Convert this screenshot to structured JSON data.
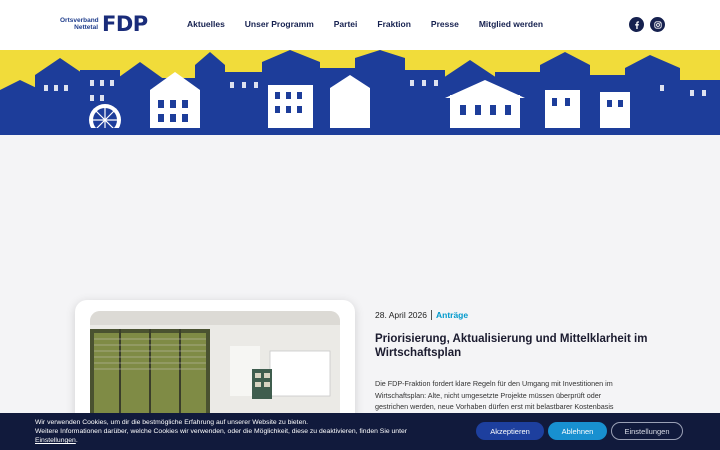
{
  "header": {
    "logo": {
      "line1": "Ortsverband",
      "line2": "Nettetal",
      "wordmark": "FDP"
    },
    "nav": [
      "Aktuelles",
      "Unser Programm",
      "Partei",
      "Fraktion",
      "Presse",
      "Mitglied werden"
    ],
    "social_icons": [
      "facebook-icon",
      "instagram-icon"
    ]
  },
  "colors": {
    "brand_blue": "#1a2c7a",
    "banner_yellow": "#f1dc3a",
    "banner_blue": "#1d3d9a",
    "accent_cyan": "#0099cc",
    "cookie_bg": "#111a3c"
  },
  "post": {
    "date": "28. April 2026",
    "category": "Anträge",
    "title": "Priorisierung, Aktualisierung und Mittelklarheit im Wirtschaftsplan",
    "excerpt": "Die FDP-Fraktion fordert klare Regeln für den Umgang mit Investitionen im Wirtschaftsplan: Alte, nicht umgesetzte Projekte müssen überprüft oder gestrichen werden, neue Vorhaben dürfen erst mit belastbarer Kostenbasis"
  },
  "cookie": {
    "line1": "Wir verwenden Cookies, um dir die bestmögliche Erfahrung auf unserer Website zu bieten.",
    "line2": "Weitere Informationen darüber, welche Cookies wir verwenden, oder die Möglichkeit, diese zu deaktivieren, finden Sie unter",
    "link": "Einstellungen",
    "accept": "Akzeptieren",
    "decline": "Ablehnen",
    "settings": "Einstellungen"
  }
}
